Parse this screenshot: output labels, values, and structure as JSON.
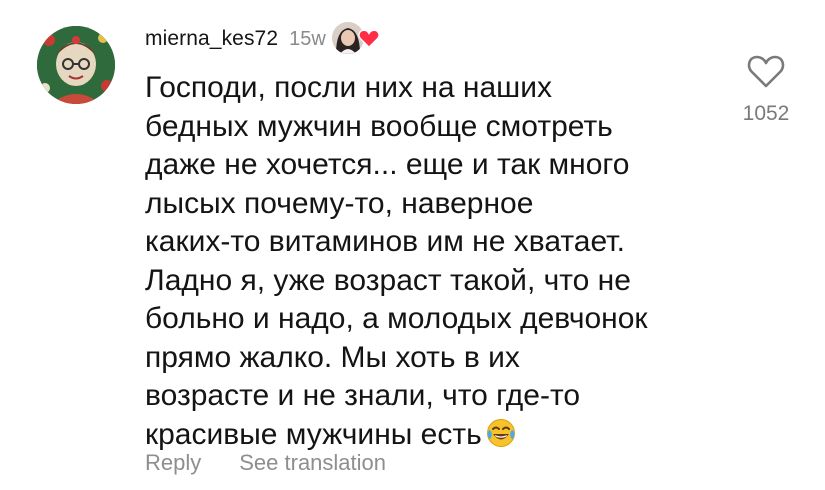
{
  "comment": {
    "username": "mierna_kes72",
    "time_ago": "15w",
    "text": "Господи, посли них на наших\nбедных мужчин вообще смотреть\nдаже не хочется... еще и так много\nлысых почему-то,  наверное\nкаких-то витаминов им не хватает.\nЛадно я, уже возраст такой, что не\nбольно и надо, а молодых девчонок\nпрямо жалко. Мы хоть в их\nвозрасте и не знали, что где-то\nкрасивые мужчины есть",
    "emoji": "face-with-tears-of-joy",
    "like_count": "1052"
  },
  "actions": {
    "reply_label": "Reply",
    "translate_label": "See translation"
  },
  "icons": {
    "like": "heart-outline-icon",
    "creator_like": "heart-filled-icon"
  },
  "colors": {
    "text": "#141414",
    "secondary": "#8e8e8e",
    "heart_red": "#ff2d45",
    "emoji_yellow": "#f7c22a"
  }
}
